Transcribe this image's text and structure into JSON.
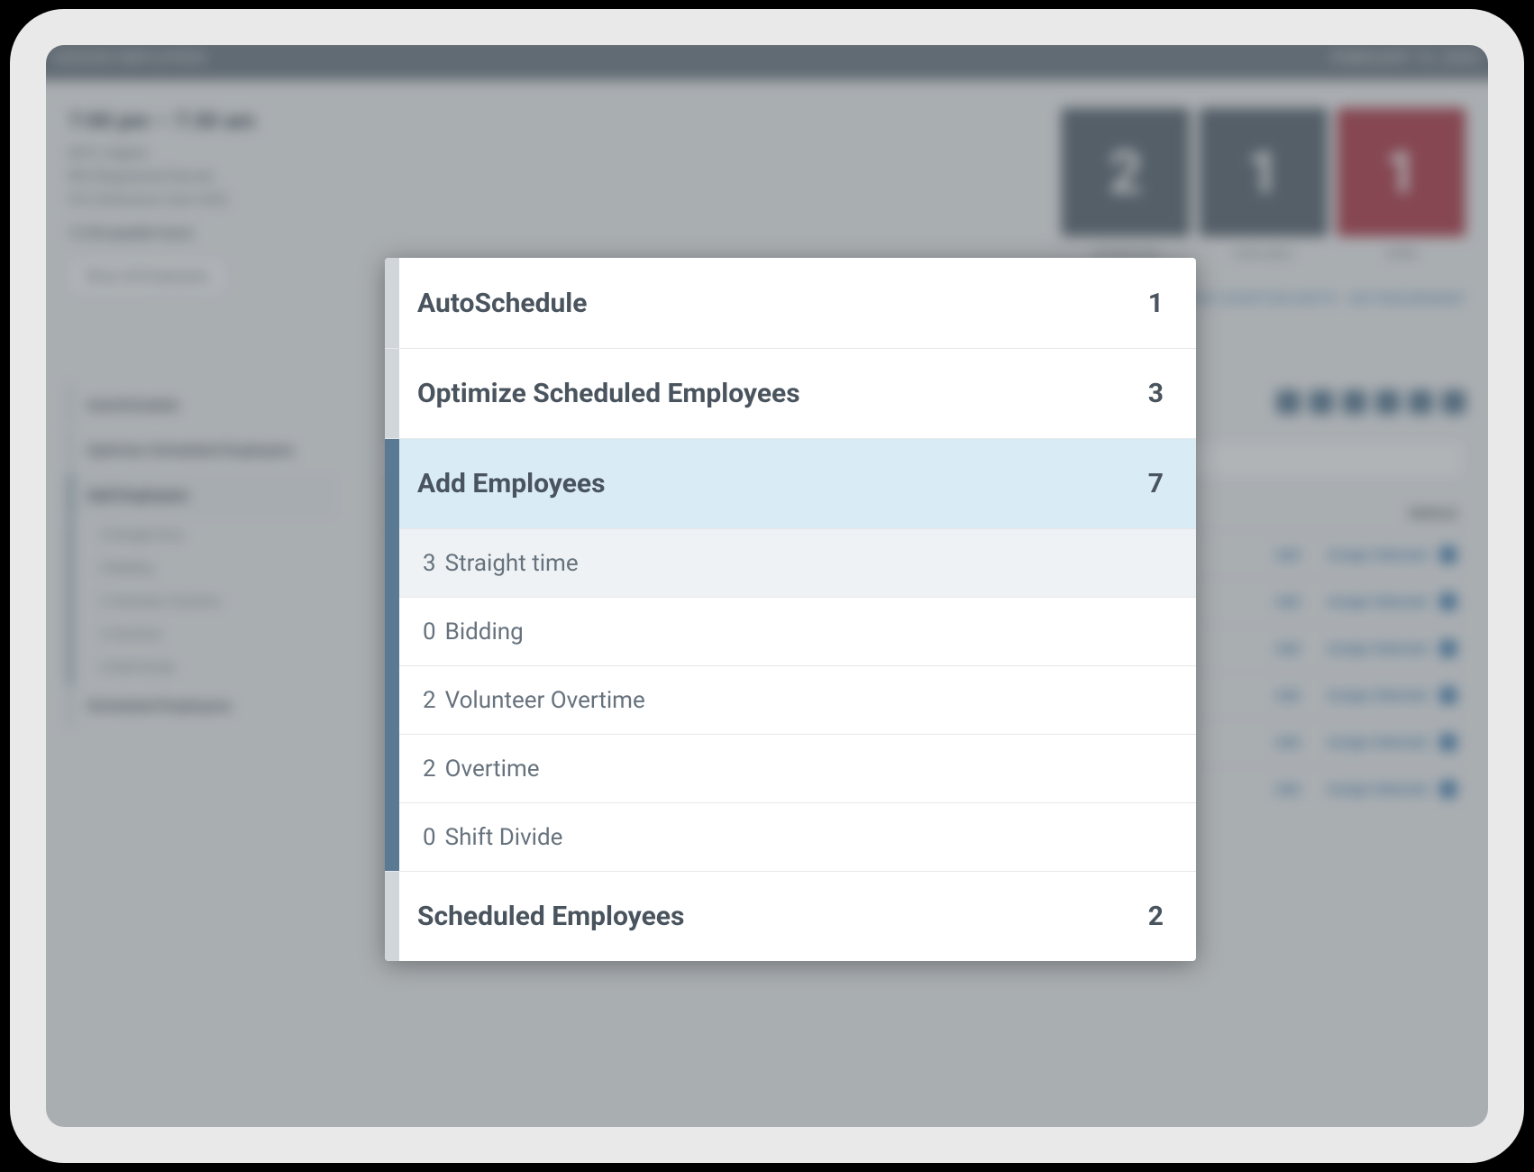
{
  "header": {
    "left": "ASSIGN EMPLOYEES",
    "right": "FEBRUARY 13, 2022"
  },
  "shift": {
    "time": "7:00 pm – 7:30 am",
    "line1": "MTS: Nights",
    "line2": "RN (Registered Nurse)",
    "line3": "ICU (Intensive Care Unit)",
    "payable": "12.00 payable hours",
    "filter_button": "Show All Employees"
  },
  "stat_cards": [
    {
      "value": "2",
      "label": "SCHEDULED",
      "color": "#5a6570"
    },
    {
      "value": "1",
      "label": "AVAILABLE",
      "color": "#5a6570"
    },
    {
      "value": "1",
      "label": "OPEN",
      "color": "#b23a48"
    }
  ],
  "links": {
    "exception": "EDIT EXCEPTION SHIFTS",
    "requirement": "EDIT REQUIREMENT"
  },
  "sidebar": [
    {
      "label": "AutoSchedule",
      "type": "item"
    },
    {
      "label": "Optimize Scheduled Employees",
      "type": "item"
    },
    {
      "label": "Add Employees",
      "type": "item",
      "active": true
    },
    {
      "label": "3 Straight time",
      "type": "sub"
    },
    {
      "label": "0 Bidding",
      "type": "sub"
    },
    {
      "label": "2 Volunteer Overtime",
      "type": "sub"
    },
    {
      "label": "2 Overtime",
      "type": "sub"
    },
    {
      "label": "0 Shift Divide",
      "type": "sub"
    },
    {
      "label": "Scheduled Employees",
      "type": "item"
    }
  ],
  "table": {
    "header_right": "Method",
    "add_label": "Add",
    "action_label": "Assign Selected"
  },
  "popover": {
    "sections": [
      {
        "title": "AutoSchedule",
        "count": "1"
      },
      {
        "title": "Optimize Scheduled Employees",
        "count": "3"
      },
      {
        "title": "Add Employees",
        "count": "7",
        "selected": true,
        "subitems": [
          {
            "count": "3",
            "label": "Straight time",
            "highlight": true
          },
          {
            "count": "0",
            "label": "Bidding"
          },
          {
            "count": "2",
            "label": "Volunteer Overtime"
          },
          {
            "count": "2",
            "label": "Overtime"
          },
          {
            "count": "0",
            "label": "Shift Divide"
          }
        ]
      },
      {
        "title": "Scheduled Employees",
        "count": "2"
      }
    ]
  }
}
